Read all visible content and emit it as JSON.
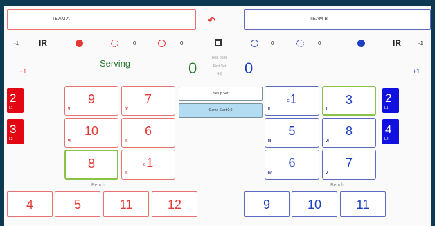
{
  "colors": {
    "team_a": "#e53935",
    "team_b": "#1e3fbf",
    "serving": "#2e7d32",
    "green_outline": "#8bc34a"
  },
  "team_a": {
    "name": "TEAM A"
  },
  "team_b": {
    "name": "TEAM B"
  },
  "toolbar": {
    "undo_icon": "undo-arrow",
    "a_minus": "-1",
    "a_ir": "IR",
    "a_timeout_count": "0",
    "a_alarm_count": "0",
    "b_alarm_count": "0",
    "b_timeout_count": "0",
    "b_ir": "IR",
    "b_minus": "-1",
    "calendar_icon": "calendar"
  },
  "score": {
    "a_plus": "+1",
    "b_plus": "+1",
    "serving_label": "Serving",
    "a": "0",
    "b": "0",
    "match_code": "H08-0028",
    "set_label": "First Set",
    "set_score": "0-0"
  },
  "controls": {
    "setup": "Setup Set",
    "start": "Game Start 0:0"
  },
  "court_a": [
    {
      "num": "9",
      "pos": "V"
    },
    {
      "num": "7",
      "pos": "IV"
    },
    {
      "num": "10",
      "pos": "VI"
    },
    {
      "num": "6",
      "pos": "III"
    },
    {
      "num": "8",
      "pos": "I"
    },
    {
      "num": "1",
      "pos": "II",
      "cap": "c"
    }
  ],
  "court_b": [
    {
      "num": "1",
      "pos": "II",
      "cap": "c"
    },
    {
      "num": "3",
      "pos": "I"
    },
    {
      "num": "5",
      "pos": "III"
    },
    {
      "num": "8",
      "pos": "VI"
    },
    {
      "num": "6",
      "pos": "IV"
    },
    {
      "num": "7",
      "pos": "V"
    }
  ],
  "libero_a": [
    {
      "num": "2",
      "label": "L1"
    },
    {
      "num": "3",
      "label": "L2"
    }
  ],
  "libero_b": [
    {
      "num": "2",
      "label": "L1"
    },
    {
      "num": "4",
      "label": "L2"
    }
  ],
  "bench_label": "Bench",
  "bench_a": [
    "4",
    "5",
    "11",
    "12"
  ],
  "bench_b": [
    "9",
    "10",
    "11"
  ]
}
